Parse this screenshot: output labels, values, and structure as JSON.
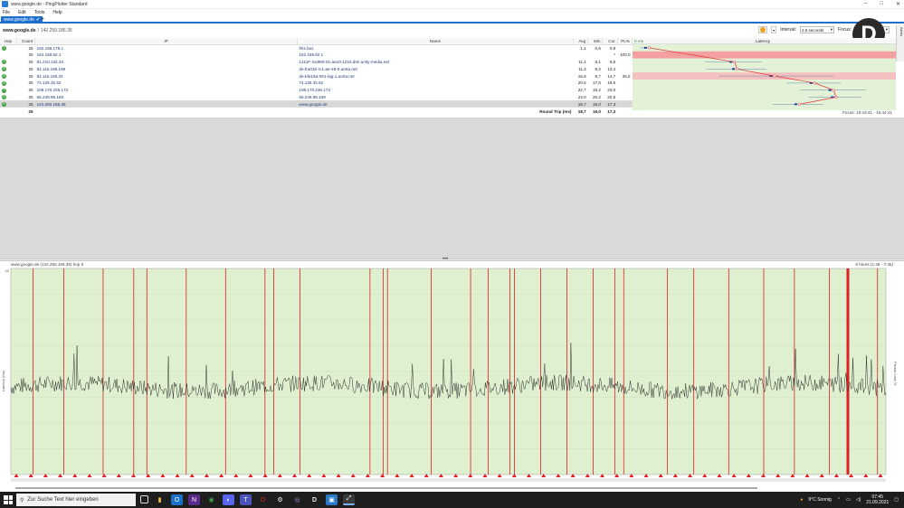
{
  "window": {
    "title": "www.google.de - PingPlotter Standard",
    "min": "–",
    "max": "□",
    "close": "✕"
  },
  "menu": [
    "File",
    "Edit",
    "Tools",
    "Help"
  ],
  "tab": {
    "label": "www.google.de",
    "add": "+"
  },
  "target": {
    "host": "www.google.de",
    "ip": "142.250.186.35",
    "sep": "/"
  },
  "controls": {
    "interval_label": "Interval:",
    "interval_value": "2.5 seconds",
    "focus_label": "Focus:",
    "focus_value": "60 seconds"
  },
  "side_tab_label": "Alerts",
  "profile_badge": "D",
  "table": {
    "headers": {
      "hop": "Hop",
      "count": "Count",
      "ip": "IP",
      "name": "Name",
      "avg": "Avg",
      "min": "Min",
      "cur": "Cur",
      "pl": "PL%",
      "latency": "Latency",
      "lat_min": "0 ms",
      "lat_max": "30 ms"
    },
    "rows": [
      {
        "hop": "1",
        "count": "25",
        "ip": "192.168.178.1",
        "name": "fritz.box",
        "avg": "1,1",
        "min": "0,5",
        "cur": "0,9",
        "pl": ""
      },
      {
        "hop": "",
        "count": "25",
        "ip": "162.158.82.1",
        "name": "162.158.82.1",
        "avg": "",
        "min": "",
        "cur": "*",
        "pl": "100,0"
      },
      {
        "hop": "3",
        "count": "25",
        "ip": "81.210.132.34",
        "name": "1211F-mx960-01-ae10-1215.dtm.unity-media.net",
        "avg": "11,1",
        "min": "8,1",
        "cur": "9,5",
        "pl": ""
      },
      {
        "hop": "4",
        "count": "25",
        "ip": "84.116.196.198",
        "name": "de-fra01b-rc1-ae-45-0.aorta.net",
        "avg": "11,4",
        "min": "8,2",
        "cur": "13,4",
        "pl": ""
      },
      {
        "hop": "5",
        "count": "25",
        "ip": "84.116.190.34",
        "name": "de-bfe18a-rt01-lag-1.aorta.net",
        "avg": "15,8",
        "min": "9,7",
        "cur": "14,7",
        "pl": "36,0"
      },
      {
        "hop": "6",
        "count": "25",
        "ip": "74.125.32.52",
        "name": "74.125.32.52",
        "avg": "20,5",
        "min": "17,6",
        "cur": "19,6",
        "pl": ""
      },
      {
        "hop": "7",
        "count": "25",
        "ip": "108.170.236.173",
        "name": "108.170.236.173",
        "avg": "22,7",
        "min": "19,2",
        "cur": "23,0",
        "pl": ""
      },
      {
        "hop": "8",
        "count": "25",
        "ip": "66.249.95.169",
        "name": "66.249.95.169",
        "avg": "23,0",
        "min": "20,2",
        "cur": "20,5",
        "pl": ""
      },
      {
        "hop": "9",
        "count": "25",
        "ip": "142.250.186.35",
        "name": "www.google.de",
        "avg": "18,7",
        "min": "16,0",
        "cur": "17,3",
        "pl": ""
      }
    ],
    "round_trip": {
      "count": "25",
      "label": "Round Trip (ms)",
      "avg": "18,7",
      "min": "16,0",
      "cur": "17,3"
    },
    "focus_range": "Focus: 15:43:41 - 15:44:41"
  },
  "graph": {
    "title": "www.google.de (142.250.186.35) hop 9",
    "range_label": "6 hours (1:45 - 7:45)",
    "ylabel_left": "Latency (ms)",
    "ylabel_right": "Packet Loss %",
    "ymax_label": "40",
    "colors": {
      "bg": "#dff0d0",
      "loss": "#e02020",
      "trace": "#1c1c1c"
    }
  },
  "chart_data": {
    "type": "line",
    "title": "www.google.de (142.250.186.35) hop 9",
    "ylabel": "Latency (ms)",
    "ylim": [
      0,
      40
    ],
    "baseline_ms": 17,
    "loss_events_fraction": [
      0.025,
      0.06,
      0.105,
      0.14,
      0.155,
      0.2,
      0.245,
      0.29,
      0.3,
      0.33,
      0.41,
      0.425,
      0.43,
      0.48,
      0.525,
      0.545,
      0.57,
      0.575,
      0.605,
      0.635,
      0.665,
      0.69,
      0.7,
      0.75,
      0.78,
      0.82,
      0.86,
      0.895,
      0.935,
      0.955,
      0.99
    ]
  },
  "taskbar": {
    "search_placeholder": "Zur Suche Text hier eingeben",
    "weather": "9°C  Sonnig",
    "time": "07:45",
    "date": "21.09.2021"
  }
}
